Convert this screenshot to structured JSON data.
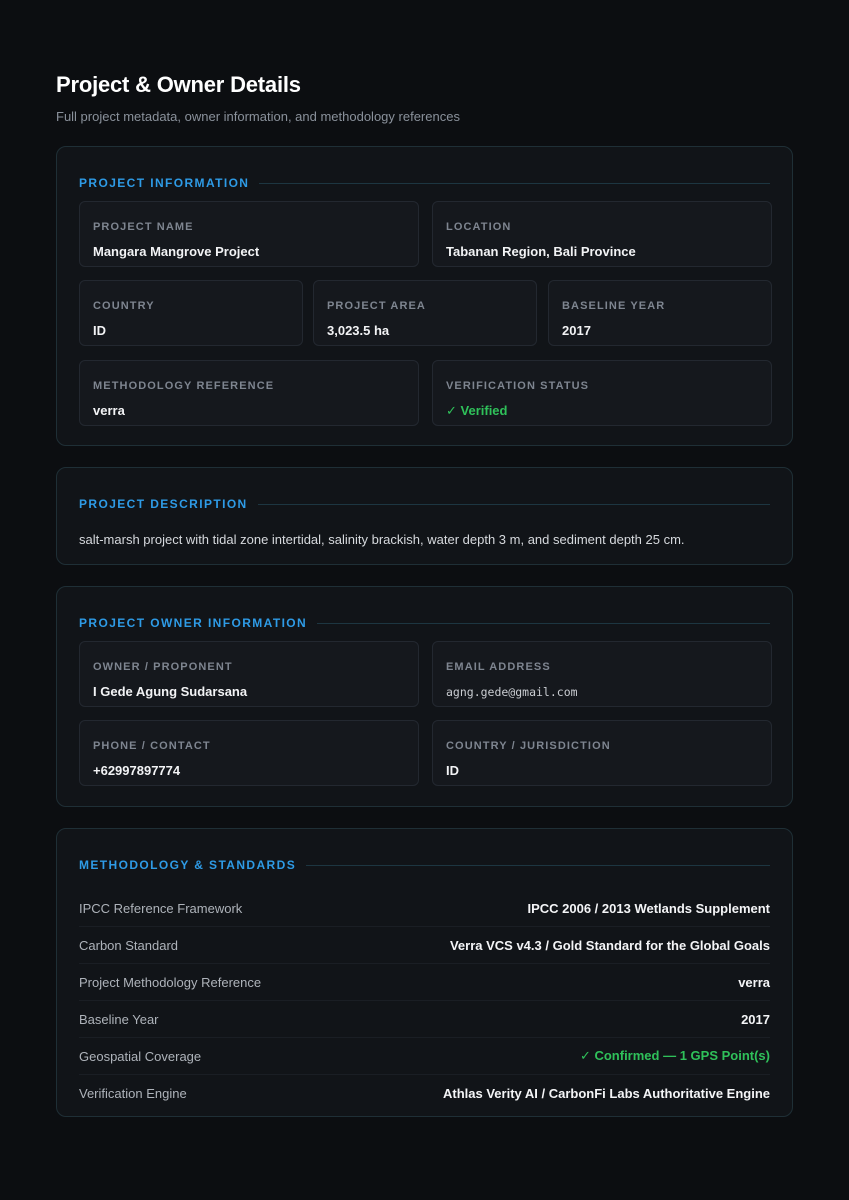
{
  "header": {
    "title": "Project & Owner Details",
    "subtitle": "Full project metadata, owner information, and methodology references"
  },
  "project_info": {
    "section_title": "PROJECT INFORMATION",
    "project_name": {
      "label": "PROJECT NAME",
      "value": "Mangara Mangrove Project"
    },
    "location": {
      "label": "LOCATION",
      "value": "Tabanan Region, Bali Province"
    },
    "country": {
      "label": "COUNTRY",
      "value": "ID"
    },
    "project_area": {
      "label": "PROJECT AREA",
      "value": "3,023.5 ha"
    },
    "baseline_year": {
      "label": "BASELINE YEAR",
      "value": "2017"
    },
    "methodology_reference": {
      "label": "METHODOLOGY REFERENCE",
      "value": "verra"
    },
    "verification_status": {
      "label": "VERIFICATION STATUS",
      "value": "✓ Verified"
    }
  },
  "project_description": {
    "section_title": "PROJECT DESCRIPTION",
    "text": "salt-marsh project with tidal zone intertidal, salinity brackish, water depth 3 m, and sediment depth 25 cm."
  },
  "owner_info": {
    "section_title": "PROJECT OWNER INFORMATION",
    "owner": {
      "label": "OWNER / PROPONENT",
      "value": "I Gede Agung Sudarsana"
    },
    "email": {
      "label": "EMAIL ADDRESS",
      "value": "agng.gede@gmail.com"
    },
    "phone": {
      "label": "PHONE / CONTACT",
      "value": "+62997897774"
    },
    "jurisdiction": {
      "label": "COUNTRY / JURISDICTION",
      "value": "ID"
    }
  },
  "methodology": {
    "section_title": "METHODOLOGY & STANDARDS",
    "rows": [
      {
        "label": "IPCC Reference Framework",
        "value": "IPCC 2006 / 2013 Wetlands Supplement"
      },
      {
        "label": "Carbon Standard",
        "value": "Verra VCS v4.3 / Gold Standard for the Global Goals"
      },
      {
        "label": "Project Methodology Reference",
        "value": "verra"
      },
      {
        "label": "Baseline Year",
        "value": "2017"
      },
      {
        "label": "Geospatial Coverage",
        "value": "✓ Confirmed — 1 GPS Point(s)"
      },
      {
        "label": "Verification Engine",
        "value": "Athlas Verity AI / CarbonFi Labs Authoritative Engine"
      }
    ]
  },
  "colors": {
    "background": "#0c0e11",
    "card": "#111418",
    "accent": "#2e9be6",
    "success": "#2fc15a"
  }
}
